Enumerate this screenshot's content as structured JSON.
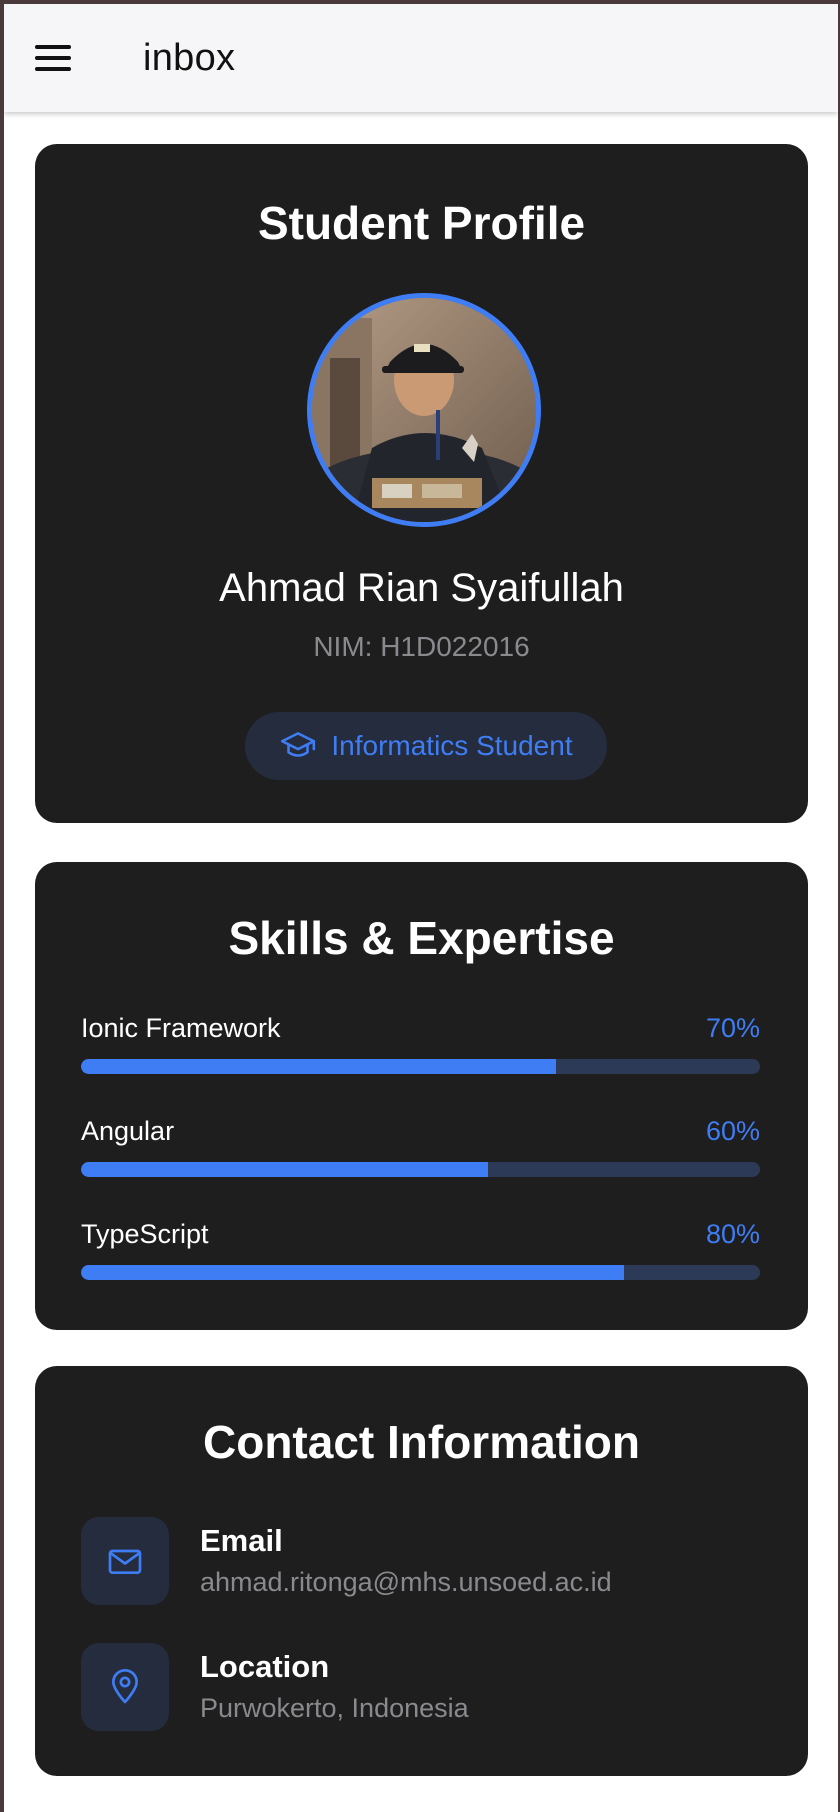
{
  "header": {
    "title": "inbox"
  },
  "profile": {
    "heading": "Student Profile",
    "name": "Ahmad Rian Syaifullah",
    "nim": "NIM: H1D022016",
    "badge": "Informatics Student",
    "badge_icon": "graduation-cap-icon"
  },
  "skills": {
    "heading": "Skills & Expertise",
    "items": [
      {
        "name": "Ionic Framework",
        "percent_label": "70%",
        "value": 70
      },
      {
        "name": "Angular",
        "percent_label": "60%",
        "value": 60
      },
      {
        "name": "TypeScript",
        "percent_label": "80%",
        "value": 80
      }
    ]
  },
  "contact": {
    "heading": "Contact Information",
    "items": [
      {
        "label": "Email",
        "value": "ahmad.ritonga@mhs.unsoed.ac.id",
        "icon": "mail-icon"
      },
      {
        "label": "Location",
        "value": "Purwokerto, Indonesia",
        "icon": "location-pin-icon"
      }
    ]
  },
  "colors": {
    "accent": "#3f7df5",
    "card": "#1e1e1f",
    "track": "#2c3a58",
    "icon_bg": "#242c3d",
    "muted_text": "#8a8a8e"
  }
}
